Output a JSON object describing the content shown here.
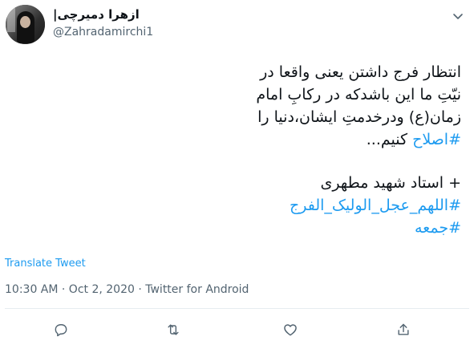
{
  "user": {
    "display_name": "ازهرا دمیرچی|",
    "handle": "@Zahradamirchi1"
  },
  "tweet": {
    "line1": "انتظار فرج داشتن یعنی واقعا در",
    "line2": "نیّتِ ما این باشدکه در رکابِ امام",
    "line3": "زمان(ع) ودرخدمتِ ایشان،دنیا را",
    "line4_hashtag": "#اصلاح",
    "line4_text": " کنیم...",
    "line5": "+ استاد شهید مطهری",
    "hashtag1": "#اللهم_عجل_الولیک_الفرج",
    "hashtag2": "#جمعه"
  },
  "translate_label": "Translate Tweet",
  "meta": "10:30 AM · Oct 2, 2020 · Twitter for Android",
  "icons": [
    "chevron-down-icon",
    "reply-icon",
    "retweet-icon",
    "like-icon",
    "share-icon"
  ],
  "colors": {
    "link": "#1d9bf0",
    "muted": "#536471",
    "text": "#0f1419",
    "divider": "#e6ecf0"
  }
}
